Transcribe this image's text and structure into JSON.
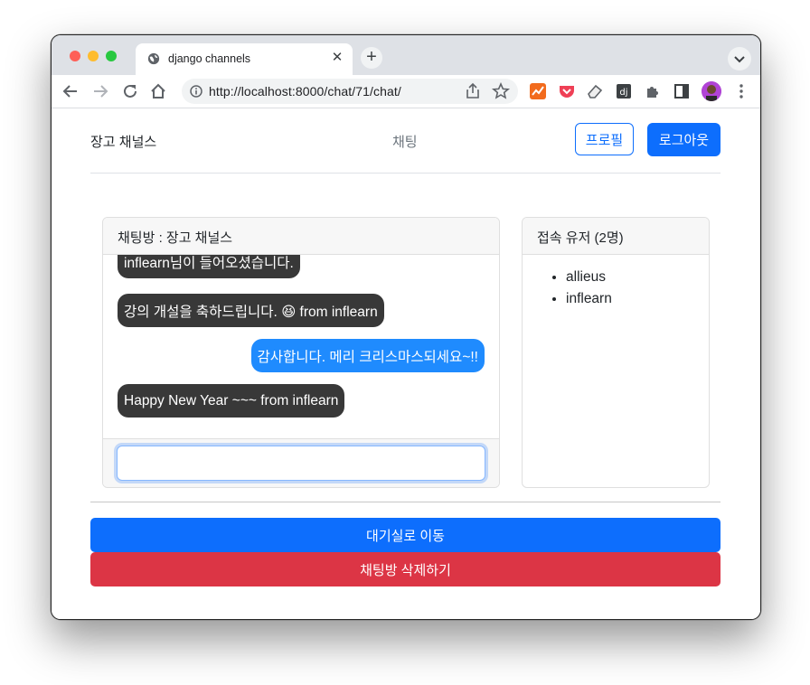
{
  "browser": {
    "tab_title": "django channels",
    "url": "http://localhost:8000/chat/71/chat/"
  },
  "navbar": {
    "brand": "장고 채널스",
    "chat_link": "채팅",
    "profile_button": "프로필",
    "logout_button": "로그아웃"
  },
  "chat_room": {
    "header": "채팅방 : 장고 채널스",
    "messages": [
      {
        "text": "inflearn님이 들어오셨습니다.",
        "sender": "other"
      },
      {
        "text": "강의 개설을 축하드립니다. 😆 from inflearn",
        "sender": "other"
      },
      {
        "text": "감사합니다. 메리 크리스마스되세요~!!",
        "sender": "mine"
      },
      {
        "text": "Happy New Year ~~~ from inflearn",
        "sender": "other"
      }
    ],
    "input_value": ""
  },
  "users_panel": {
    "header": "접속 유저 (2명)",
    "users": [
      "allieus",
      "inflearn"
    ]
  },
  "actions": {
    "lobby_button": "대기실로 이동",
    "delete_button": "채팅방 삭제하기"
  },
  "colors": {
    "primary": "#0d6efd",
    "danger": "#dc3545",
    "bubble_other": "#383838",
    "bubble_mine": "#1f8bfe"
  }
}
